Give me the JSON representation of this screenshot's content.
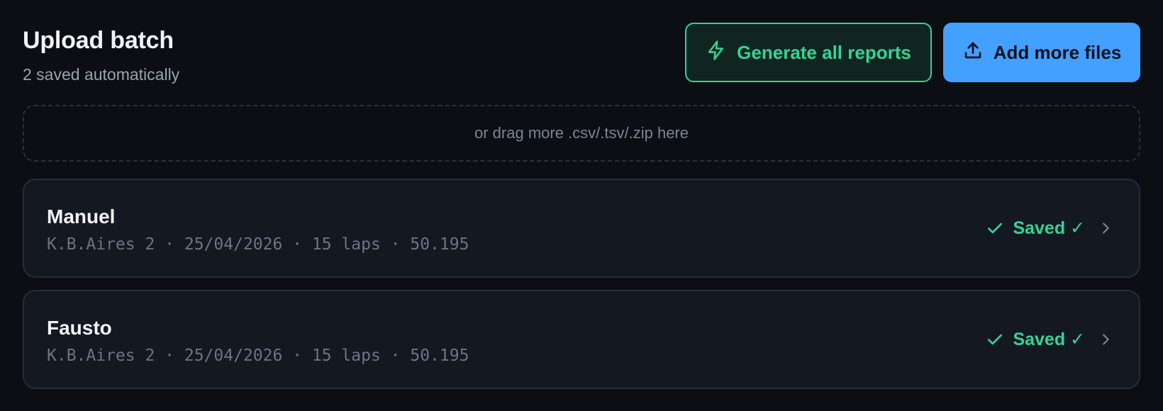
{
  "header": {
    "title": "Upload batch",
    "subtitle": "2 saved automatically",
    "generate_label": "Generate all reports",
    "add_label": "Add more files"
  },
  "dropzone": {
    "hint": "or drag more .csv/.tsv/.zip here"
  },
  "sessions": [
    {
      "name": "Manuel",
      "meta": "K.B.Aires 2 · 25/04/2026 · 15 laps · 50.195",
      "status": "Saved ✓"
    },
    {
      "name": "Fausto",
      "meta": "K.B.Aires 2 · 25/04/2026 · 15 laps · 50.195",
      "status": "Saved ✓"
    }
  ],
  "icons": {
    "generate": "lightning-icon",
    "add": "upload-icon",
    "status": "check-icon",
    "row_action": "chevron-right-icon"
  },
  "colors": {
    "accent_green": "#34d399",
    "accent_blue": "#44a0ff",
    "background": "#0b0e13"
  }
}
